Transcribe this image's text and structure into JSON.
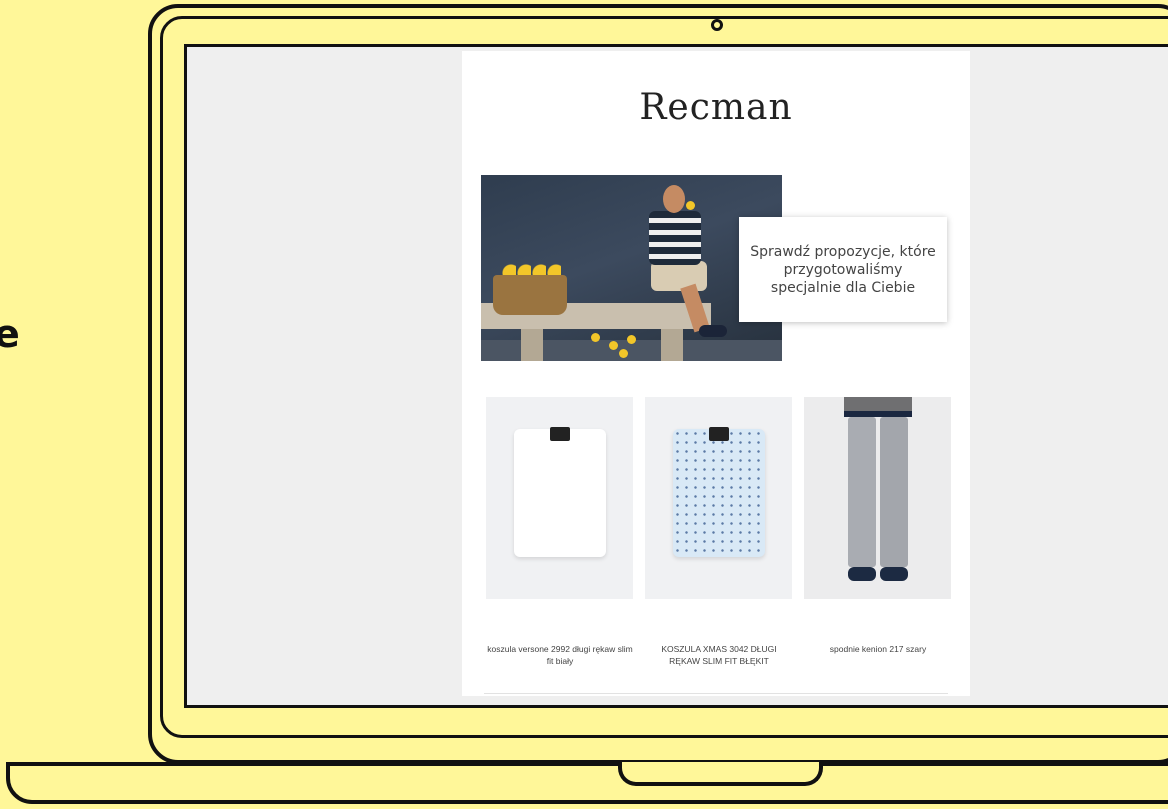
{
  "side_text": "e",
  "email": {
    "brand": "Recman",
    "hero": {
      "message": "Sprawdź propozycje, które przygotowaliśmy specjalnie dla Ciebie"
    },
    "products": [
      {
        "name": "koszula versone 2992 długi rękaw slim fit biały"
      },
      {
        "name": "KOSZULA XMAS 3042 DŁUGI RĘKAW SLIM FIT BŁĘKIT"
      },
      {
        "name": "spodnie kenion 217 szary"
      }
    ]
  },
  "colors": {
    "background": "#fff799",
    "outline": "#111111",
    "screen": "#efefef"
  }
}
